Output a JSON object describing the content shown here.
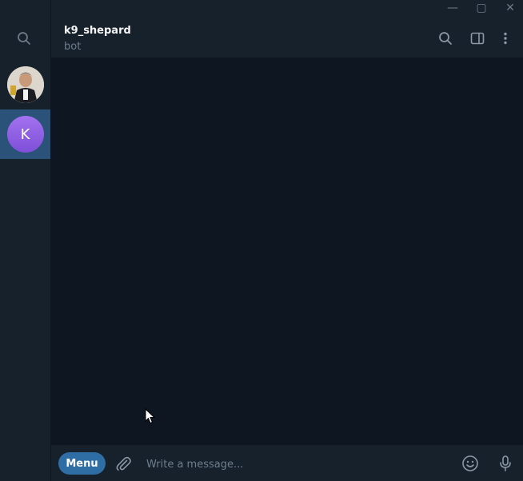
{
  "window": {
    "minimize_glyph": "—",
    "maximize_glyph": "▢",
    "close_glyph": "✕"
  },
  "sidebar": {
    "search_icon": "search-icon",
    "chats": [
      {
        "type": "photo",
        "name": "",
        "initial": ""
      },
      {
        "type": "letter",
        "name": "k9_shepard",
        "initial": "K",
        "active": true
      }
    ]
  },
  "header": {
    "title": "k9_shepard",
    "status": "bot",
    "icons": [
      "search-icon",
      "sidebar-panel-icon",
      "more-vertical-icon"
    ]
  },
  "composer": {
    "menu_label": "Menu",
    "placeholder": "Write a message...",
    "icons": [
      "paperclip-icon",
      "emoji-icon",
      "microphone-icon"
    ]
  },
  "colors": {
    "background": "#17212b",
    "messages_bg": "#0e1621",
    "accent": "#2f6ea5",
    "active_chat": "#2b5278",
    "muted_text": "#6d7f8f"
  }
}
